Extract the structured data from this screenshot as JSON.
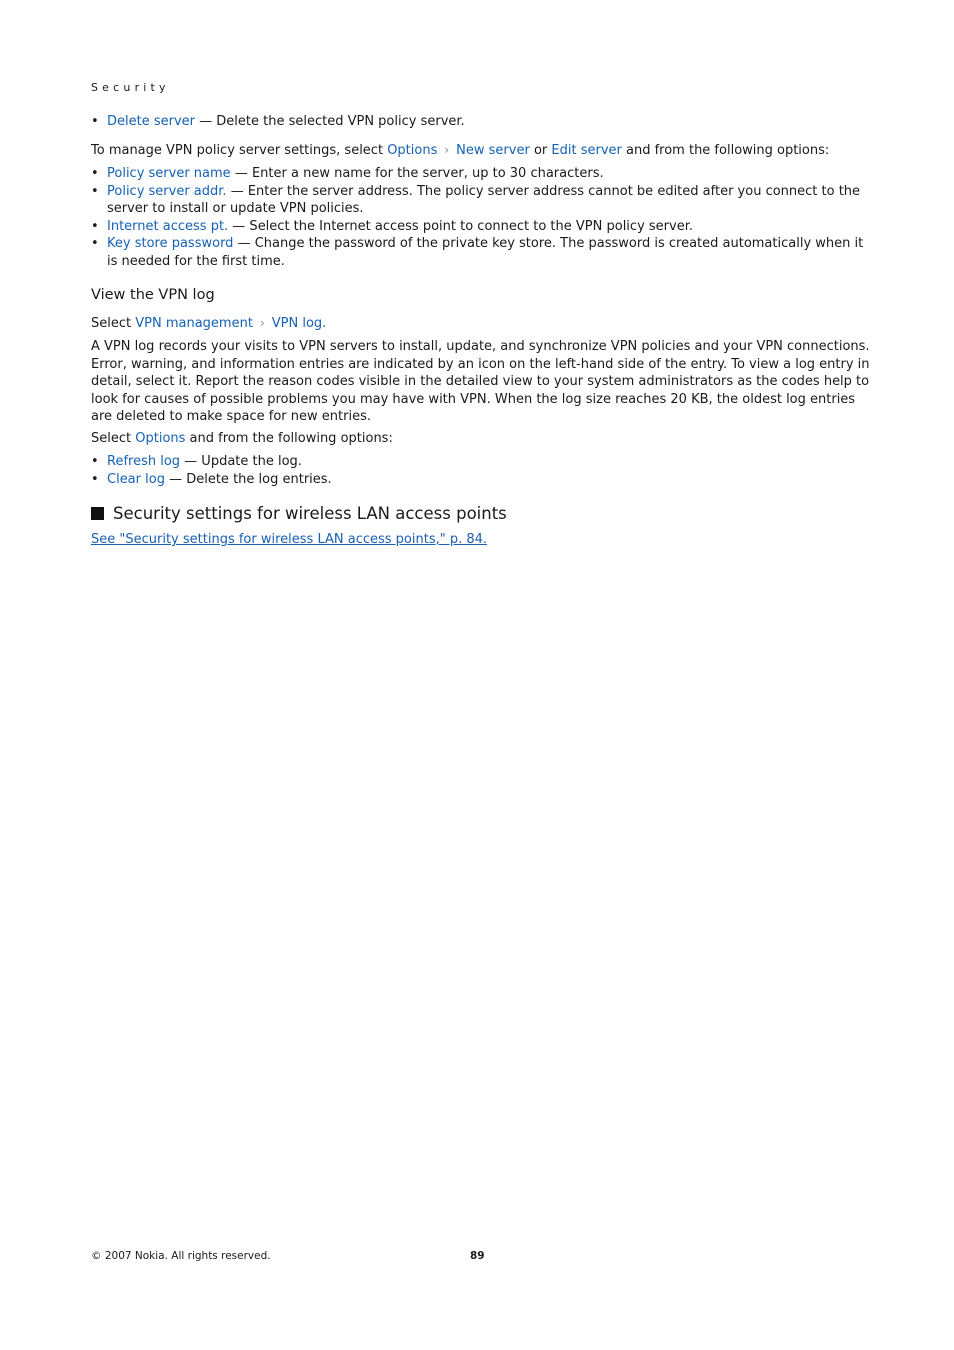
{
  "running_head": "Security",
  "section1": {
    "bullet_delete": {
      "term": "Delete server",
      "desc": " — Delete the selected VPN policy server."
    },
    "manage_intro": {
      "pre": "To manage VPN policy server settings, select ",
      "options": "Options",
      "new_server": "New server",
      "or": " or ",
      "edit_server": "Edit server",
      "post": " and from the following options:"
    },
    "items": [
      {
        "term": "Policy server name",
        "desc": " — Enter a new name for the server, up to 30 characters."
      },
      {
        "term": "Policy server addr.",
        "desc": " — Enter the server address. The policy server address cannot be edited after you connect to the server to install or update VPN policies."
      },
      {
        "term": "Internet access pt.",
        "desc": " — Select the Internet access point to connect to the VPN policy server."
      },
      {
        "term": "Key store password",
        "desc": " — Change the password of the private key store. The password is created automatically when it is needed for the first time."
      }
    ]
  },
  "vpn_log": {
    "heading": "View the VPN log",
    "select_pre": "Select ",
    "path1": "VPN management",
    "path2": "VPN log",
    "path_end": ".",
    "paragraph": "A VPN log records your visits to VPN servers to install, update, and synchronize VPN policies and your VPN connections. Error, warning, and information entries are indicated by an icon on the left-hand side of the entry. To view a log entry in detail, select it. Report the reason codes visible in the detailed view to your system administrators as the codes help to look for causes of possible problems you may have with VPN. When the log size reaches 20 KB, the oldest log entries are deleted to make space for new entries.",
    "options_pre": "Select ",
    "options": "Options",
    "options_post": " and from the following options:",
    "items": [
      {
        "term": "Refresh log",
        "desc": " — Update the log."
      },
      {
        "term": "Clear log",
        "desc": " — Delete the log entries."
      }
    ]
  },
  "wlan": {
    "heading": "Security settings for wireless LAN access points",
    "xref": "See \"Security settings for wireless LAN access points,\" p. 84."
  },
  "footer": {
    "copyright": "© 2007 Nokia. All rights reserved.",
    "page_number": "89"
  }
}
